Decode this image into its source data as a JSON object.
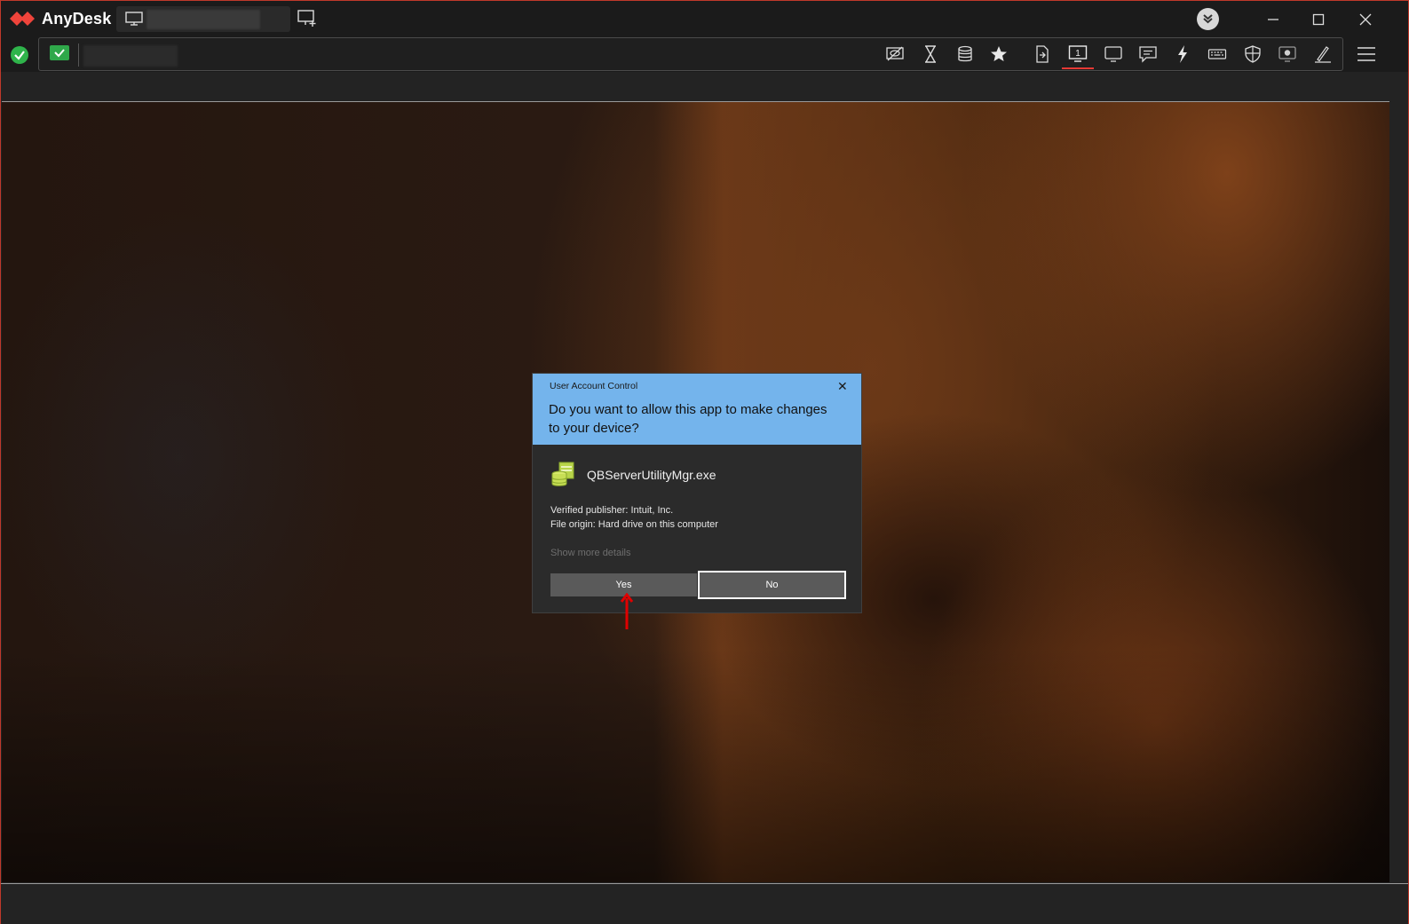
{
  "app": {
    "name": "AnyDesk"
  },
  "titlebar": {
    "session_tab_label": "",
    "colors": {
      "brand": "#ef443b",
      "background": "#1b1b1b"
    }
  },
  "toolbar": {
    "address_text": "",
    "icons": [
      "privacy-off-icon",
      "hourglass-icon",
      "database-icon",
      "star-icon",
      "file-transfer-icon",
      "display-1-icon",
      "monitor-icon",
      "chat-icon",
      "actions-bolt-icon",
      "keyboard-icon",
      "permissions-shield-icon",
      "recording-icon",
      "whiteboard-pen-icon",
      "menu-icon"
    ],
    "active_icon": "display-1-icon",
    "display_number": "1"
  },
  "uac_dialog": {
    "window_title": "User Account Control",
    "close_glyph": "✕",
    "question": "Do you want to allow this app to make changes to your device?",
    "app_name": "QBServerUtilityMgr.exe",
    "publisher_line": "Verified publisher: Intuit, Inc.",
    "origin_line": "File origin: Hard drive on this computer",
    "more_details": "Show more details",
    "yes_label": "Yes",
    "no_label": "No",
    "colors": {
      "header": "#74b4ec",
      "body": "#2b2b2b"
    }
  },
  "annotation": {
    "arrow_color": "#e00000",
    "points_to": "yes-button"
  }
}
